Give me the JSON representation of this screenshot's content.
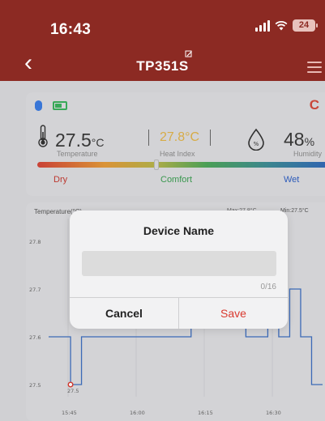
{
  "status_bar": {
    "time": "16:43",
    "battery_level": "24"
  },
  "nav": {
    "title": "TP351S"
  },
  "device_status": {
    "bluetooth": "connected",
    "battery": "good"
  },
  "readings": {
    "temperature": {
      "value": "27.5",
      "unit": "°C",
      "label": "Temperature"
    },
    "heat_index": {
      "value": "27.8°C",
      "label": "Heat Index"
    },
    "humidity": {
      "value": "48",
      "unit": "%",
      "label": "Humidity"
    }
  },
  "comfort_scale": {
    "dry": "Dry",
    "comfort": "Comfort",
    "wet": "Wet"
  },
  "chart": {
    "title": "Temperature(°C)",
    "max_text": "Max:27.8°C",
    "min_text": "Min:27.5°C",
    "y_ticks": [
      "27.8",
      "27.7",
      "27.6",
      "27.5"
    ],
    "x_ticks": [
      "15:45",
      "16:00",
      "16:15",
      "16:30"
    ],
    "min_point_label": "27.5"
  },
  "chart_data": {
    "type": "line",
    "title": "Temperature(°C)",
    "xlabel": "",
    "ylabel": "",
    "ylim": [
      27.5,
      27.8
    ],
    "x_ticks": [
      "15:45",
      "16:00",
      "16:15",
      "16:30"
    ],
    "y_ticks": [
      27.8,
      27.7,
      27.6,
      27.5
    ],
    "series": [
      {
        "values": [
          27.6,
          27.6,
          27.5,
          27.6,
          27.6,
          27.6,
          27.6,
          27.6,
          27.6,
          27.6,
          27.6,
          27.6,
          27.6,
          27.7,
          27.7,
          27.8,
          27.8,
          27.7,
          27.6,
          27.6,
          27.7,
          27.6,
          27.7,
          27.6,
          27.5,
          27.5
        ]
      }
    ],
    "annotations": [
      {
        "label": "27.5",
        "y": 27.5
      }
    ]
  },
  "dialog": {
    "title": "Device Name",
    "input_value": "",
    "char_count": "0/16",
    "cancel_label": "Cancel",
    "save_label": "Save"
  }
}
